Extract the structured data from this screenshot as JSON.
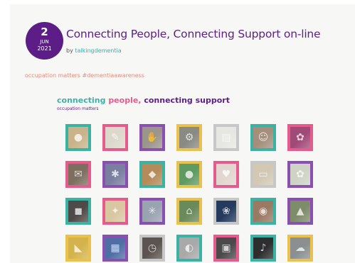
{
  "post": {
    "day": "2",
    "month": "JUN",
    "year": "2021",
    "title": "Connecting People, Connecting Support on-line",
    "by_label": "by",
    "author": "talkingdementia",
    "tags": "occupation matters #dementiaawareness"
  },
  "gallery": {
    "title_word1": "connecting",
    "title_word2": "people,",
    "title_word3": "connecting support",
    "subtitle": "occupation matters"
  },
  "colors": {
    "purple": "#5c1e86",
    "teal": "#3bb3a4",
    "pink": "#e65a8c",
    "yellow": "#eac14c",
    "tag": "#e88a78"
  },
  "tiles": [
    {
      "name": "tile-cookies-photo",
      "border": "teal",
      "bg": "#c9b48a",
      "icon": "●"
    },
    {
      "name": "tile-handwriting-photo",
      "border": "pink",
      "bg": "#ddd8cc",
      "icon": "✎"
    },
    {
      "name": "tile-hands-craft-photo",
      "border": "purple",
      "bg": "#9a968c",
      "icon": "✋"
    },
    {
      "name": "tile-sewing-machine-photo",
      "border": "yellow",
      "bg": "#8a8a84",
      "icon": "⚙"
    },
    {
      "name": "tile-notes-photo",
      "border": "gray",
      "bg": "#e6e6e2",
      "icon": "▤"
    },
    {
      "name": "tile-couple-selfie-photo",
      "border": "teal",
      "bg": "#a58f7c",
      "icon": "☺"
    },
    {
      "name": "tile-flowers-photo",
      "border": "pink",
      "bg": "#a04a78",
      "icon": "✿"
    },
    {
      "name": "tile-letter-photo",
      "border": "pink",
      "bg": "#7c6f60",
      "icon": "✉"
    },
    {
      "name": "tile-painting-photo",
      "border": "purple",
      "bg": "#7a7fa0",
      "icon": "✱"
    },
    {
      "name": "tile-cake-photo",
      "border": "teal",
      "bg": "#b58b5a",
      "icon": "◆"
    },
    {
      "name": "tile-balloons-photo",
      "border": "yellow",
      "bg": "#5f9a62",
      "icon": "●"
    },
    {
      "name": "tile-playing-cards-photo",
      "border": "pink",
      "bg": "#e2d6d0",
      "icon": "♥"
    },
    {
      "name": "tile-book-photo",
      "border": "gray",
      "bg": "#d2c8b4",
      "icon": "▭"
    },
    {
      "name": "tile-pressed-flowers-photo",
      "border": "purple",
      "bg": "#cfd3c6",
      "icon": "✿"
    },
    {
      "name": "tile-cube-photo",
      "border": "teal",
      "bg": "#4e4a48",
      "icon": "◼"
    },
    {
      "name": "tile-puzzle-photo",
      "border": "pink",
      "bg": "#d9c7a2",
      "icon": "✦"
    },
    {
      "name": "tile-colored-pencils-photo",
      "border": "purple",
      "bg": "#9aa3b0",
      "icon": "✳"
    },
    {
      "name": "tile-garden-photo",
      "border": "yellow",
      "bg": "#6b8a5c",
      "icon": "⌂"
    },
    {
      "name": "tile-water-lily-photo",
      "border": "gray",
      "bg": "#243a5e",
      "icon": "❀"
    },
    {
      "name": "tile-cat-photo",
      "border": "teal",
      "bg": "#9a7a63",
      "icon": "◉"
    },
    {
      "name": "tile-hiker-photo",
      "border": "purple",
      "bg": "#7e8c6a",
      "icon": "▲"
    },
    {
      "name": "tile-origami-photo",
      "border": "yellow",
      "bg": "#d4b34e",
      "icon": "◣"
    },
    {
      "name": "tile-paint-palette-photo",
      "border": "purple",
      "bg": "#4f6ea4",
      "icon": "▦"
    },
    {
      "name": "tile-clock-photo",
      "border": "gray",
      "bg": "#5c5450",
      "icon": "◷"
    },
    {
      "name": "tile-face-photo",
      "border": "teal",
      "bg": "#a9a9a9",
      "icon": "◐"
    },
    {
      "name": "tile-radio-photo",
      "border": "pink",
      "bg": "#4a4a4a",
      "icon": "▣"
    },
    {
      "name": "tile-dancing-photo",
      "border": "teal",
      "bg": "#2e2e2e",
      "icon": "♪"
    },
    {
      "name": "tile-landscape-photo",
      "border": "yellow",
      "bg": "#8c8f92",
      "icon": "☁"
    }
  ]
}
